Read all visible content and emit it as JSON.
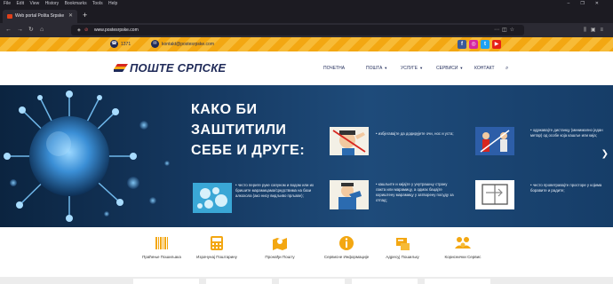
{
  "browser": {
    "menu": [
      "File",
      "Edit",
      "View",
      "History",
      "Bookmarks",
      "Tools",
      "Help"
    ],
    "tab_title": "Web portal Pošta Srpske",
    "new_tab": "+",
    "url": "www.postesrpske.com"
  },
  "topbar": {
    "phone": "1371",
    "email": "kontakt@postesrpske.com",
    "social": [
      "f",
      "◎",
      "t",
      "▶"
    ]
  },
  "header": {
    "logo": "ПОШТЕ СРПСКЕ",
    "nav": [
      "ПОЧЕТНА",
      "ПОШТА",
      "УСЛУГЕ",
      "СЕРВИСИ",
      "КОНТАКТ"
    ]
  },
  "hero": {
    "title_lines": [
      "КАКО БИ",
      "ЗАШТИТИЛИ",
      "СЕБЕ И ДРУГЕ:"
    ],
    "tips": [
      "• избјегавајте да додирујете очи, нос и уста;",
      "• одржавајте дистанцу (минимално један метар) од особе која кашље или кија;",
      "• често перите руке сапуном и водом или их бришите марамицама/средствима на бази алкохола (ако нису видљиво прљаве);",
      "• кашљите и кијајте у унутрашњу страну лакта или марамицу, а одмах бацајте кориштену марамицу у затворену посуду за отпад;",
      "• често проветравајте просторе у којима боравите и радите;"
    ]
  },
  "services": [
    {
      "label": "Праћење Пошиљака"
    },
    {
      "label": "Израчунај Поштарину"
    },
    {
      "label": "Пронађи Пошту"
    },
    {
      "label": "Сервисне Информације"
    },
    {
      "label": "Адресуј Пошиљку"
    },
    {
      "label": "Кориснички Сервис"
    }
  ],
  "colors": {
    "brand_navy": "#1f2a58",
    "brand_orange": "#f3a712",
    "brand_red": "#d7261f"
  }
}
